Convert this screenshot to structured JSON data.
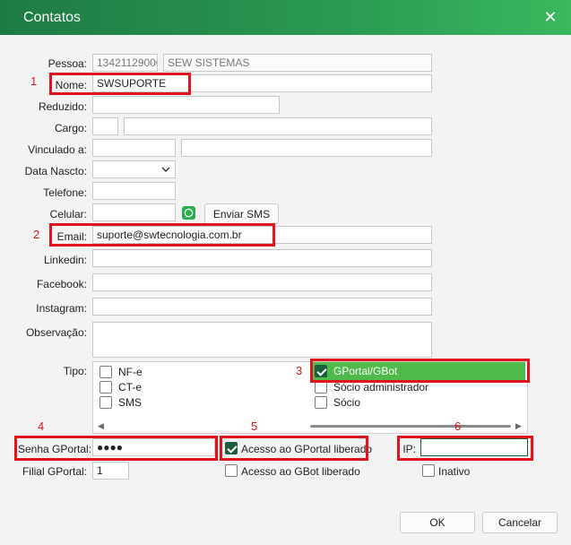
{
  "window": {
    "title": "Contatos",
    "close_icon": "close-icon"
  },
  "fields": {
    "pessoa": {
      "label": "Pessoa:",
      "code": "13421129000",
      "name": "SEW SISTEMAS"
    },
    "nome": {
      "label": "Nome:",
      "value": "SWSUPORTE"
    },
    "reduzido": {
      "label": "Reduzido:",
      "value": ""
    },
    "cargo": {
      "label": "Cargo:",
      "value": ""
    },
    "vinculado": {
      "label": "Vinculado a:",
      "value": ""
    },
    "data_nascto": {
      "label": "Data Nascto:",
      "value": ""
    },
    "telefone": {
      "label": "Telefone:",
      "value": ""
    },
    "celular": {
      "label": "Celular:",
      "value": "",
      "sms_button": "Enviar SMS"
    },
    "email": {
      "label": "Email:",
      "value": "suporte@swtecnologia.com.br"
    },
    "linkedin": {
      "label": "Linkedin:",
      "value": ""
    },
    "facebook": {
      "label": "Facebook:",
      "value": ""
    },
    "instagram": {
      "label": "Instagram:",
      "value": ""
    },
    "observacao": {
      "label": "Observação:",
      "value": ""
    },
    "tipo": {
      "label": "Tipo:",
      "left_items": [
        {
          "label": "NF-e",
          "checked": false
        },
        {
          "label": "CT-e",
          "checked": false
        },
        {
          "label": "SMS",
          "checked": false
        }
      ],
      "right_items": [
        {
          "label": "GPortal/GBot",
          "checked": true
        },
        {
          "label": "Sócio administrador",
          "checked": false
        },
        {
          "label": "Sócio",
          "checked": false
        }
      ]
    },
    "senha_gportal": {
      "label": "Senha GPortal:",
      "value": "●●●●"
    },
    "acesso_gportal": {
      "label": "Acesso ao GPortal liberado",
      "checked": true
    },
    "acesso_gbot": {
      "label": "Acesso ao GBot liberado",
      "checked": false
    },
    "ip": {
      "label": "IP:",
      "value": ""
    },
    "inativo": {
      "label": "Inativo",
      "checked": false
    },
    "filial_gportal": {
      "label": "Filial GPortal:",
      "value": "1"
    }
  },
  "annotations": [
    "1",
    "2",
    "3",
    "4",
    "5",
    "6"
  ],
  "buttons": {
    "ok": "OK",
    "cancel": "Cancelar"
  },
  "colors": {
    "titlebar": "#2a9a52",
    "highlight": "#4fb94b",
    "annotation": "#e0141c",
    "checked": "#1b5e3b"
  }
}
